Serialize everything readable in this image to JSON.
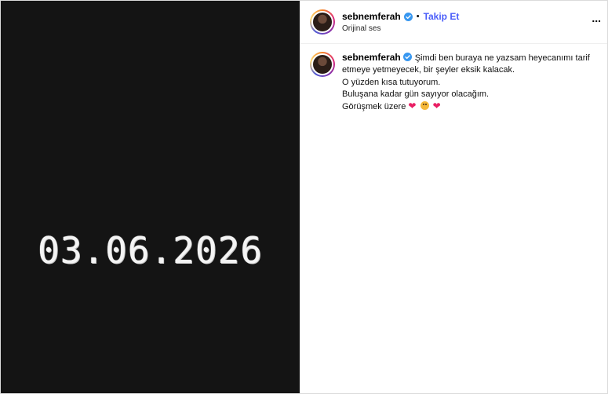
{
  "media": {
    "date_text": "03.06.2026"
  },
  "header": {
    "username": "sebnemferah",
    "separator": "•",
    "follow_label": "Takip Et",
    "audio_label": "Orijinal ses",
    "more_label": "..."
  },
  "caption": {
    "username": "sebnemferah",
    "line1": "Şimdi ben buraya ne yazsam heyecanımı tarif etmeye yetmeyecek, bir şeyler eksik kalacak.",
    "line2": "O yüzden kısa tutuyorum.",
    "line3": "Buluşana kadar gün sayıyor olacağım.",
    "line4": "Görüşmek üzere",
    "emoji_1": "❤",
    "emoji_2": "smiling-face-with-tear",
    "emoji_3": "❤"
  },
  "colors": {
    "follow": "#4a5df9",
    "verified": "#3897f0",
    "heart": "#e91e63",
    "media_bg": "#141414"
  }
}
